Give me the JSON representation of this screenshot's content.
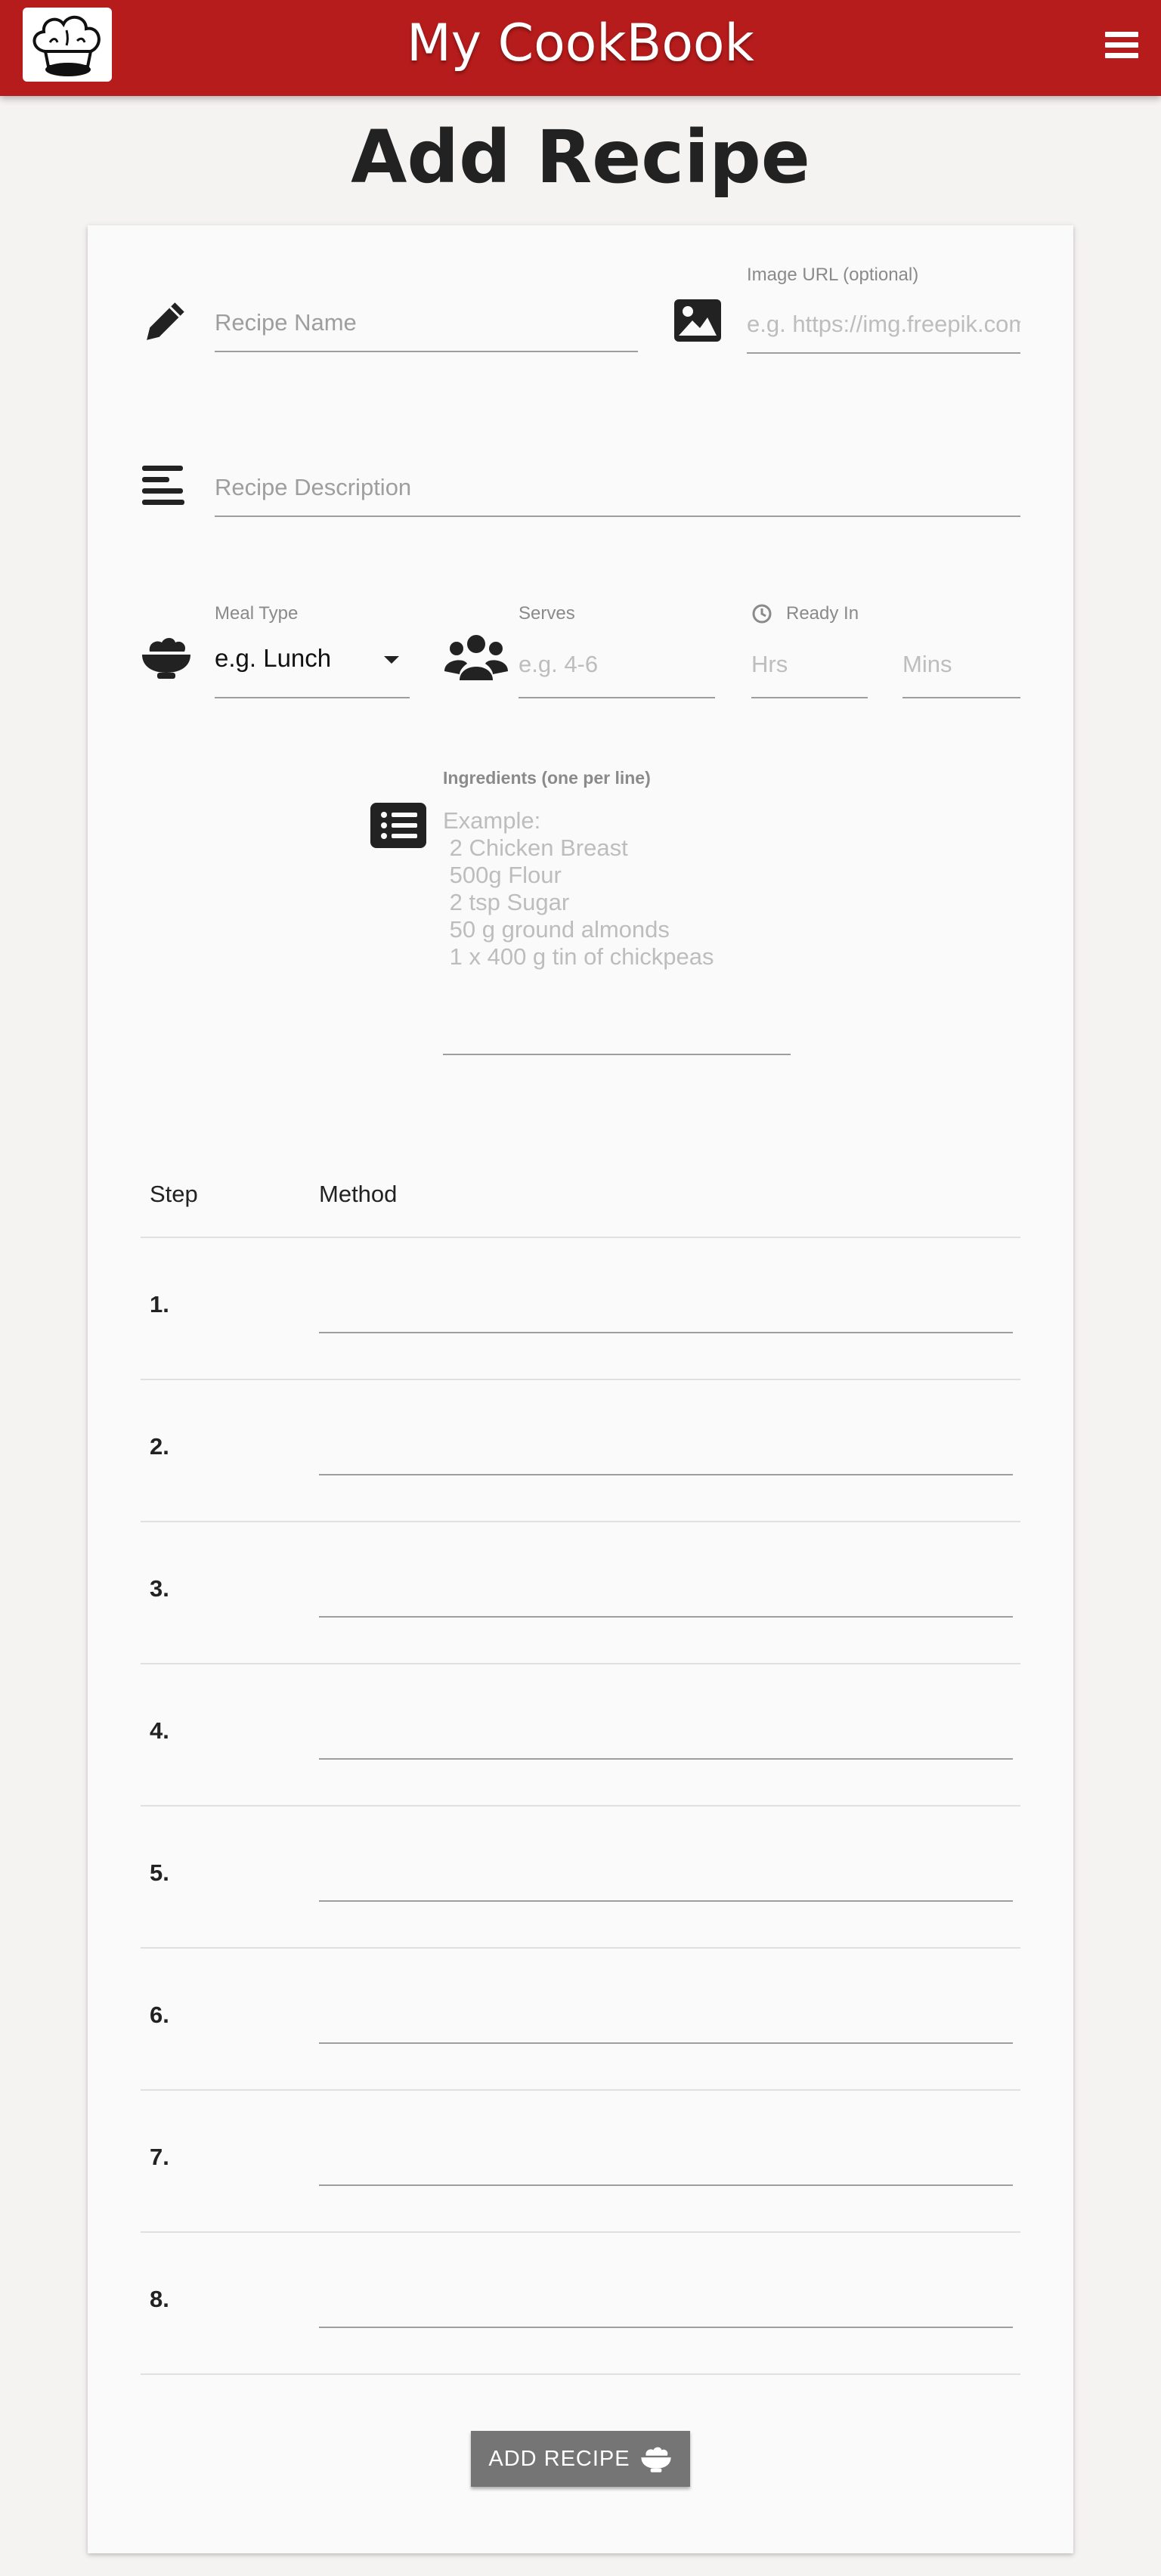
{
  "header": {
    "brand": "My CookBook",
    "logo_icon": "chef-hat-icon",
    "menu_icon": "hamburger-menu-icon",
    "color": "#b71c1c"
  },
  "page": {
    "title": "Add Recipe"
  },
  "form": {
    "recipe_name": {
      "placeholder": "Recipe Name",
      "icon": "pencil-icon"
    },
    "image_url": {
      "label": "Image URL (optional)",
      "placeholder": "e.g. https://img.freepik.com",
      "icon": "image-icon"
    },
    "description": {
      "placeholder": "Recipe Description",
      "icon": "align-left-icon"
    },
    "meal_type": {
      "label": "Meal Type",
      "value": "e.g. Lunch",
      "icon": "bowl-icon"
    },
    "serves": {
      "label": "Serves",
      "placeholder": "e.g. 4-6",
      "icon": "people-icon"
    },
    "ready_in": {
      "label": "Ready In",
      "hrs_placeholder": "Hrs",
      "mins_placeholder": "Mins",
      "icon": "clock-icon"
    },
    "ingredients": {
      "label": "Ingredients (one per line)",
      "placeholder": "Example:\n 2 Chicken Breast\n 500g Flour\n 2 tsp Sugar\n 50 g ground almonds\n 1 x 400 g tin of chickpeas",
      "icon": "list-icon"
    }
  },
  "steps": {
    "headers": {
      "step": "Step",
      "method": "Method"
    },
    "rows": [
      "1.",
      "2.",
      "3.",
      "4.",
      "5.",
      "6.",
      "7.",
      "8."
    ]
  },
  "submit": {
    "label": "ADD RECIPE",
    "icon": "bowl-icon",
    "color": "#757575"
  }
}
